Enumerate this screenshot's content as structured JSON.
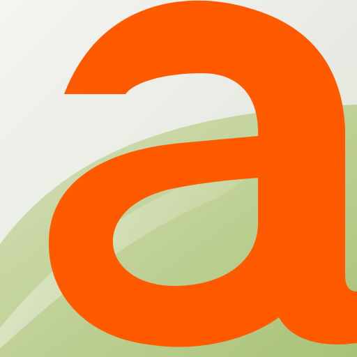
{
  "app_icon": {
    "icon_name": "letter-a-app-icon",
    "glyph": "a",
    "colors": {
      "letter": "#FF5A00",
      "background_top": "#F2F2EE",
      "background_mid": "#E3E7DC",
      "green_light": "#CBD8A8",
      "green_dark": "#A8C172",
      "highlight": "#FFFFFF"
    }
  }
}
